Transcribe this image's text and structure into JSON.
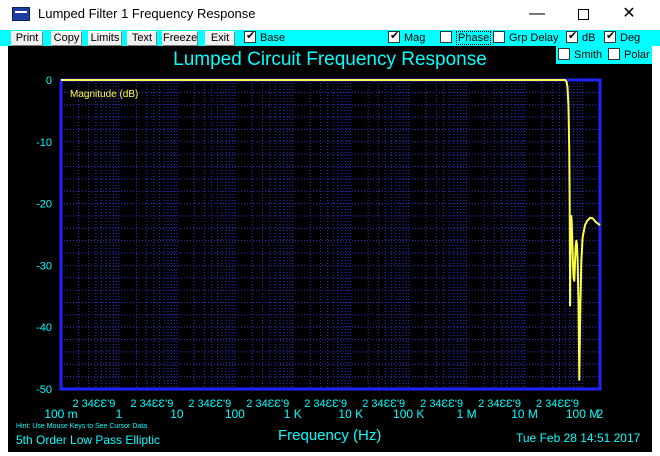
{
  "window": {
    "title": "Lumped Filter 1 Frequency Response",
    "controls": {
      "minimize": "—",
      "close": "✕"
    }
  },
  "toolbar": {
    "buttons": [
      "Print",
      "Copy",
      "Limits",
      "Text",
      "Freeze",
      "Exit"
    ],
    "checkboxes": [
      {
        "label": "Base",
        "checked": true
      },
      {
        "label": "Mag",
        "checked": true
      },
      {
        "label": "Phase",
        "checked": false
      },
      {
        "label": "Grp Delay",
        "checked": false
      },
      {
        "label": "dB",
        "checked": true
      },
      {
        "label": "Deg",
        "checked": true
      },
      {
        "label": "Smith",
        "checked": false
      },
      {
        "label": "Polar",
        "checked": false
      }
    ]
  },
  "colors": {
    "background": "#000000",
    "accent": "#00ffff",
    "frame": "#2222ff",
    "grid": "#3030c8",
    "trace": "#ffff44"
  },
  "chart_data": {
    "type": "line",
    "title": "Lumped Circuit Frequency Response",
    "xlabel": "Frequency (Hz)",
    "ylabel": "",
    "x_scale": "log",
    "xlim": [
      0.1,
      200000000
    ],
    "ylim": [
      -50,
      0
    ],
    "grid": true,
    "y_ticks": [
      "0",
      "-10",
      "-20",
      "-30",
      "-40",
      "-50"
    ],
    "x_ticks": [
      {
        "label": "100 m",
        "x": 0.1
      },
      {
        "label": "1",
        "x": 1
      },
      {
        "label": "10",
        "x": 10
      },
      {
        "label": "100",
        "x": 100
      },
      {
        "label": "1 K",
        "x": 1000
      },
      {
        "label": "10 K",
        "x": 10000
      },
      {
        "label": "100 K",
        "x": 100000
      },
      {
        "label": "1 M",
        "x": 1000000
      },
      {
        "label": "10 M",
        "x": 10000000
      },
      {
        "label": "100 M",
        "x": 100000000
      },
      {
        "label": "2",
        "x": 200000000
      }
    ],
    "minor_tick_label": "2 34ƐƐ'9",
    "series": [
      {
        "name": "Magnitude (dB)",
        "x": [
          0.1,
          1000,
          10000000,
          50000000,
          53000000,
          55000000,
          57000000,
          58000000,
          59000000,
          60000000,
          61000000,
          62000000,
          63000000,
          64000000,
          65000000,
          66000000,
          68000000,
          70000000,
          72000000,
          74000000,
          76000000,
          78000000,
          80000000,
          82000000,
          85000000,
          88000000,
          91000000,
          95000000,
          100000000,
          110000000,
          120000000,
          135000000,
          150000000,
          170000000,
          200000000
        ],
        "y": [
          0,
          0,
          0,
          0,
          -0.3,
          -1.2,
          -4,
          -7,
          -12,
          -20,
          -36.5,
          -25,
          -22.5,
          -22,
          -23,
          -25,
          -29,
          -32,
          -32.5,
          -29.5,
          -27,
          -26,
          -26.5,
          -29,
          -36,
          -48.5,
          -38,
          -29.5,
          -25.5,
          -23.5,
          -22.8,
          -22.3,
          -22.4,
          -23,
          -23.5
        ]
      }
    ]
  },
  "status": {
    "hint": "Hint: Use Mouse Keys to See Cursor Data",
    "subtitle": "5th Order Low Pass Elliptic",
    "datetime": "Tue Feb 28 14:51 2017"
  }
}
